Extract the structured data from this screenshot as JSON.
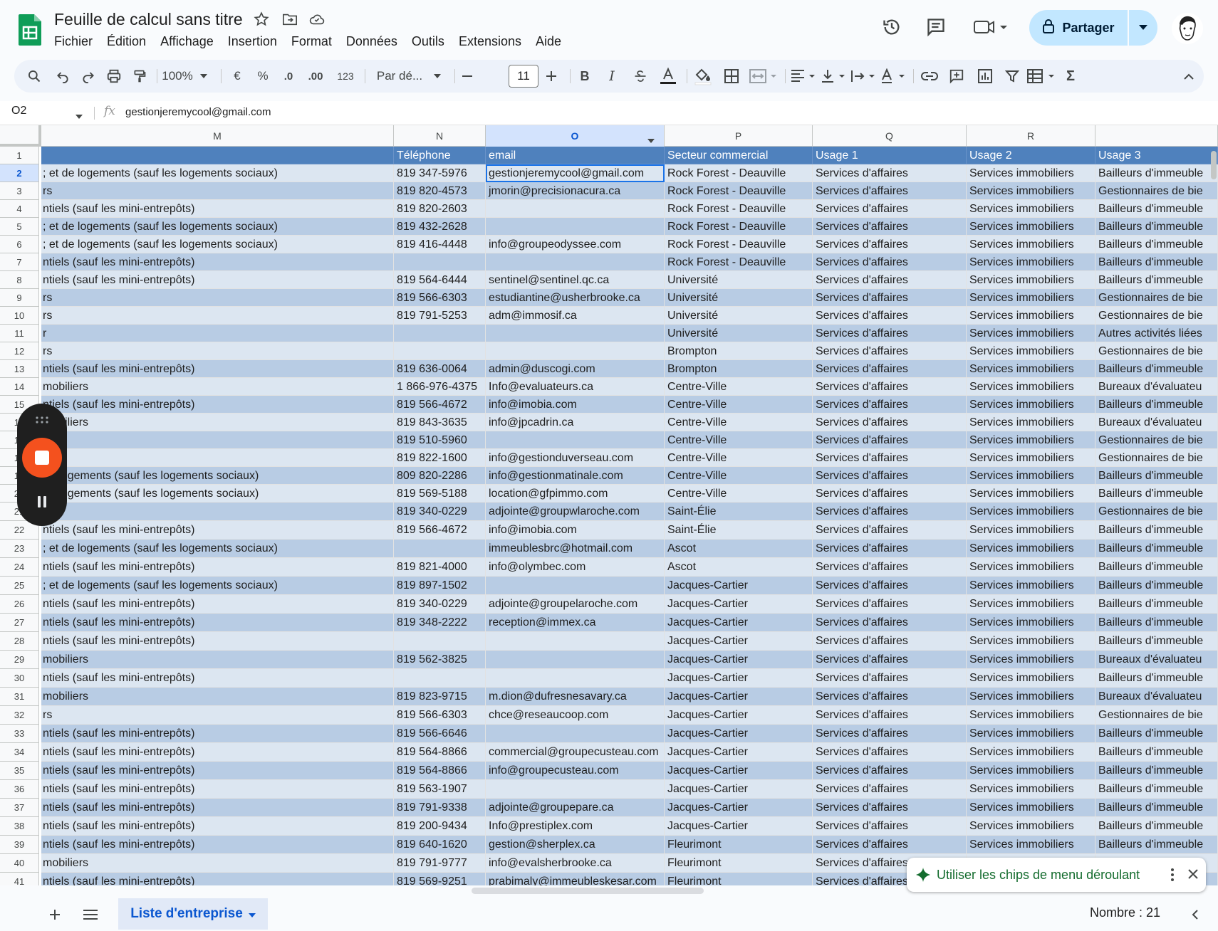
{
  "app": {
    "title": "Feuille de calcul sans titre",
    "menu": [
      "Fichier",
      "Édition",
      "Affichage",
      "Insertion",
      "Format",
      "Données",
      "Outils",
      "Extensions",
      "Aide"
    ],
    "share_label": "Partager"
  },
  "toolbar": {
    "zoom": "100%",
    "currency": "€",
    "percent": "%",
    "dec_less": ".0",
    "dec_more": ".00",
    "number_format": "123",
    "font": "Par dé...",
    "font_size": "11"
  },
  "formula_bar": {
    "cell_ref": "O2",
    "fx": "fx",
    "value": "gestionjeremycool@gmail.com"
  },
  "grid": {
    "columns": [
      "M",
      "N",
      "O",
      "P",
      "Q",
      "R",
      ""
    ],
    "selected_column": "O",
    "selected_row": "2",
    "rows": [
      {
        "n": "1",
        "c": [
          "",
          "Téléphone",
          "email",
          "Secteur commercial",
          "Usage 1",
          "Usage 2",
          "Usage 3"
        ]
      },
      {
        "n": "2",
        "c": [
          "; et de logements (sauf les logements sociaux)",
          "819 347-5976",
          "gestionjeremycool@gmail.com",
          "Rock Forest - Deauville",
          "Services d'affaires",
          "Services immobiliers",
          "Bailleurs d'immeuble"
        ]
      },
      {
        "n": "3",
        "c": [
          "rs",
          "819 820-4573",
          "jmorin@precisionacura.ca",
          "Rock Forest - Deauville",
          "Services d'affaires",
          "Services immobiliers",
          "Gestionnaires de bie"
        ]
      },
      {
        "n": "4",
        "c": [
          "ntiels (sauf les mini-entrepôts)",
          "819 820-2603",
          "",
          "Rock Forest - Deauville",
          "Services d'affaires",
          "Services immobiliers",
          "Bailleurs d'immeuble"
        ]
      },
      {
        "n": "5",
        "c": [
          "; et de logements (sauf les logements sociaux)",
          "819 432-2628",
          "",
          "Rock Forest - Deauville",
          "Services d'affaires",
          "Services immobiliers",
          "Bailleurs d'immeuble"
        ]
      },
      {
        "n": "6",
        "c": [
          "; et de logements (sauf les logements sociaux)",
          "819 416-4448",
          "info@groupeodyssee.com",
          "Rock Forest - Deauville",
          "Services d'affaires",
          "Services immobiliers",
          "Bailleurs d'immeuble"
        ]
      },
      {
        "n": "7",
        "c": [
          "ntiels (sauf les mini-entrepôts)",
          "",
          "",
          "Rock Forest - Deauville",
          "Services d'affaires",
          "Services immobiliers",
          "Bailleurs d'immeuble"
        ]
      },
      {
        "n": "8",
        "c": [
          "ntiels (sauf les mini-entrepôts)",
          "819 564-6444",
          "sentinel@sentinel.qc.ca",
          "Université",
          "Services d'affaires",
          "Services immobiliers",
          "Bailleurs d'immeuble"
        ]
      },
      {
        "n": "9",
        "c": [
          "rs",
          "819 566-6303",
          "estudiantine@usherbrooke.ca",
          "Université",
          "Services d'affaires",
          "Services immobiliers",
          "Gestionnaires de bie"
        ]
      },
      {
        "n": "10",
        "c": [
          "rs",
          "819 791-5253",
          "adm@immosif.ca",
          "Université",
          "Services d'affaires",
          "Services immobiliers",
          "Gestionnaires de bie"
        ]
      },
      {
        "n": "11",
        "c": [
          "r",
          "",
          "",
          "Université",
          "Services d'affaires",
          "Services immobiliers",
          "Autres activités liées"
        ]
      },
      {
        "n": "12",
        "c": [
          "rs",
          "",
          "",
          "Brompton",
          "Services d'affaires",
          "Services immobiliers",
          "Gestionnaires de bie"
        ]
      },
      {
        "n": "13",
        "c": [
          "ntiels (sauf les mini-entrepôts)",
          "819 636-0064",
          "admin@duscogi.com",
          "Brompton",
          "Services d'affaires",
          "Services immobiliers",
          "Bailleurs d'immeuble"
        ]
      },
      {
        "n": "14",
        "c": [
          "mobiliers",
          "1 866-976-4375",
          "Info@evaluateurs.ca",
          "Centre-Ville",
          "Services d'affaires",
          "Services immobiliers",
          "Bureaux d'évaluateu"
        ]
      },
      {
        "n": "15",
        "c": [
          "ntiels (sauf les mini-entrepôts)",
          "819 566-4672",
          "info@imobia.com",
          "Centre-Ville",
          "Services d'affaires",
          "Services immobiliers",
          "Bailleurs d'immeuble"
        ]
      },
      {
        "n": "16",
        "c": [
          "mobiliers",
          "819 843-3635",
          "info@jpcadrin.ca",
          "Centre-Ville",
          "Services d'affaires",
          "Services immobiliers",
          "Bureaux d'évaluateu"
        ]
      },
      {
        "n": "17",
        "c": [
          "",
          "819 510-5960",
          "",
          "Centre-Ville",
          "Services d'affaires",
          "Services immobiliers",
          "Gestionnaires de bie"
        ]
      },
      {
        "n": "18",
        "c": [
          "",
          "819 822-1600",
          "info@gestionduverseau.com",
          "Centre-Ville",
          "Services d'affaires",
          "Services immobiliers",
          "Gestionnaires de bie"
        ]
      },
      {
        "n": "19",
        "c": [
          "de logements (sauf les logements sociaux)",
          "809 820-2286",
          "info@gestionmatinale.com",
          "Centre-Ville",
          "Services d'affaires",
          "Services immobiliers",
          "Bailleurs d'immeuble"
        ]
      },
      {
        "n": "20",
        "c": [
          "de logements (sauf les logements sociaux)",
          "819 569-5188",
          "location@gfpimmo.com",
          "Centre-Ville",
          "Services d'affaires",
          "Services immobiliers",
          "Bailleurs d'immeuble"
        ]
      },
      {
        "n": "21",
        "c": [
          "",
          "819 340-0229",
          "adjointe@groupwlaroche.com",
          "Saint-Élie",
          "Services d'affaires",
          "Services immobiliers",
          "Gestionnaires de bie"
        ]
      },
      {
        "n": "22",
        "c": [
          "ntiels (sauf les mini-entrepôts)",
          "819 566-4672",
          "info@imobia.com",
          "Saint-Élie",
          "Services d'affaires",
          "Services immobiliers",
          "Bailleurs d'immeuble"
        ]
      },
      {
        "n": "23",
        "c": [
          "; et de logements (sauf les logements sociaux)",
          "",
          "immeublesbrc@hotmail.com",
          "Ascot",
          "Services d'affaires",
          "Services immobiliers",
          "Bailleurs d'immeuble"
        ]
      },
      {
        "n": "24",
        "c": [
          "ntiels (sauf les mini-entrepôts)",
          "819 821-4000",
          "info@olymbec.com",
          "Ascot",
          "Services d'affaires",
          "Services immobiliers",
          "Bailleurs d'immeuble"
        ]
      },
      {
        "n": "25",
        "c": [
          "; et de logements (sauf les logements sociaux)",
          "819 897-1502",
          "",
          "Jacques-Cartier",
          "Services d'affaires",
          "Services immobiliers",
          "Bailleurs d'immeuble"
        ]
      },
      {
        "n": "26",
        "c": [
          "ntiels (sauf les mini-entrepôts)",
          "819 340-0229",
          "adjointe@groupelaroche.com",
          "Jacques-Cartier",
          "Services d'affaires",
          "Services immobiliers",
          "Bailleurs d'immeuble"
        ]
      },
      {
        "n": "27",
        "c": [
          "ntiels (sauf les mini-entrepôts)",
          "819 348-2222",
          "reception@immex.ca",
          "Jacques-Cartier",
          "Services d'affaires",
          "Services immobiliers",
          "Bailleurs d'immeuble"
        ]
      },
      {
        "n": "28",
        "c": [
          "ntiels (sauf les mini-entrepôts)",
          "",
          "",
          "Jacques-Cartier",
          "Services d'affaires",
          "Services immobiliers",
          "Bailleurs d'immeuble"
        ]
      },
      {
        "n": "29",
        "c": [
          "mobiliers",
          "819 562-3825",
          "",
          "Jacques-Cartier",
          "Services d'affaires",
          "Services immobiliers",
          "Bureaux d'évaluateu"
        ]
      },
      {
        "n": "30",
        "c": [
          "ntiels (sauf les mini-entrepôts)",
          "",
          "",
          "Jacques-Cartier",
          "Services d'affaires",
          "Services immobiliers",
          "Bailleurs d'immeuble"
        ]
      },
      {
        "n": "31",
        "c": [
          "mobiliers",
          "819 823-9715",
          "m.dion@dufresnesavary.ca",
          "Jacques-Cartier",
          "Services d'affaires",
          "Services immobiliers",
          "Bureaux d'évaluateu"
        ]
      },
      {
        "n": "32",
        "c": [
          "rs",
          "819 566-6303",
          "chce@reseaucoop.com",
          "Jacques-Cartier",
          "Services d'affaires",
          "Services immobiliers",
          "Gestionnaires de bie"
        ]
      },
      {
        "n": "33",
        "c": [
          "ntiels (sauf les mini-entrepôts)",
          "819 566-6646",
          "",
          "Jacques-Cartier",
          "Services d'affaires",
          "Services immobiliers",
          "Bailleurs d'immeuble"
        ]
      },
      {
        "n": "34",
        "c": [
          "ntiels (sauf les mini-entrepôts)",
          "819 564-8866",
          "commercial@groupecusteau.com",
          "Jacques-Cartier",
          "Services d'affaires",
          "Services immobiliers",
          "Bailleurs d'immeuble"
        ]
      },
      {
        "n": "35",
        "c": [
          "ntiels (sauf les mini-entrepôts)",
          "819 564-8866",
          "info@groupecusteau.com",
          "Jacques-Cartier",
          "Services d'affaires",
          "Services immobiliers",
          "Bailleurs d'immeuble"
        ]
      },
      {
        "n": "36",
        "c": [
          "ntiels (sauf les mini-entrepôts)",
          "819 563-1907",
          "",
          "Jacques-Cartier",
          "Services d'affaires",
          "Services immobiliers",
          "Bailleurs d'immeuble"
        ]
      },
      {
        "n": "37",
        "c": [
          "ntiels (sauf les mini-entrepôts)",
          "819 791-9338",
          "adjointe@groupepare.ca",
          "Jacques-Cartier",
          "Services d'affaires",
          "Services immobiliers",
          "Bailleurs d'immeuble"
        ]
      },
      {
        "n": "38",
        "c": [
          "ntiels (sauf les mini-entrepôts)",
          "819 200-9434",
          "Info@prestiplex.com",
          "Jacques-Cartier",
          "Services d'affaires",
          "Services immobiliers",
          "Bailleurs d'immeuble"
        ]
      },
      {
        "n": "39",
        "c": [
          "ntiels (sauf les mini-entrepôts)",
          "819 640-1620",
          "gestion@sherplex.ca",
          "Fleurimont",
          "Services d'affaires",
          "Services immobiliers",
          "Bailleurs d'immeuble"
        ]
      },
      {
        "n": "40",
        "c": [
          "mobiliers",
          "819 791-9777",
          "info@evalsherbrooke.ca",
          "Fleurimont",
          "Services d'affaires",
          "Services immobiliers",
          "Bureaux d'évaluateu"
        ]
      },
      {
        "n": "41",
        "c": [
          "ntiels (sauf les mini-entrepôts)",
          "819 569-9251",
          "prabimaly@immeubleskesar.com",
          "Fleurimont",
          "Services d'affaires",
          "Services immobiliers",
          "Bailleurs d'immeuble"
        ]
      }
    ]
  },
  "chip_toast": {
    "text": "Utiliser les chips de menu déroulant"
  },
  "footer": {
    "sheet_tab": "Liste d'entreprise",
    "status": "Nombre : 21"
  },
  "colors": {
    "header_fill": "#4f81bd",
    "band_light": "#dce6f1",
    "band_dark": "#b8cce4",
    "share_button": "#c2e7ff",
    "accent": "#0b57d0",
    "recorder_stop": "#f4511e"
  },
  "icons": [
    "sheets-logo-icon",
    "star-icon",
    "move-to-folder-icon",
    "cloud-saved-icon",
    "history-icon",
    "comment-icon",
    "meet-icon",
    "lock-icon",
    "search-icon",
    "undo-icon",
    "redo-icon",
    "print-icon",
    "paint-format-icon",
    "bold-icon",
    "italic-icon",
    "strikethrough-icon",
    "text-color-icon",
    "fill-color-icon",
    "borders-icon",
    "merge-cells-icon",
    "align-icon",
    "valign-icon",
    "wrap-icon",
    "rotate-icon",
    "link-icon",
    "insert-comment-icon",
    "insert-chart-icon",
    "filter-icon",
    "table-icon",
    "functions-icon",
    "collapse-icon",
    "sparkle-icon",
    "more-icon",
    "close-icon",
    "add-sheet-icon",
    "all-sheets-icon",
    "collapse-side-icon"
  ]
}
